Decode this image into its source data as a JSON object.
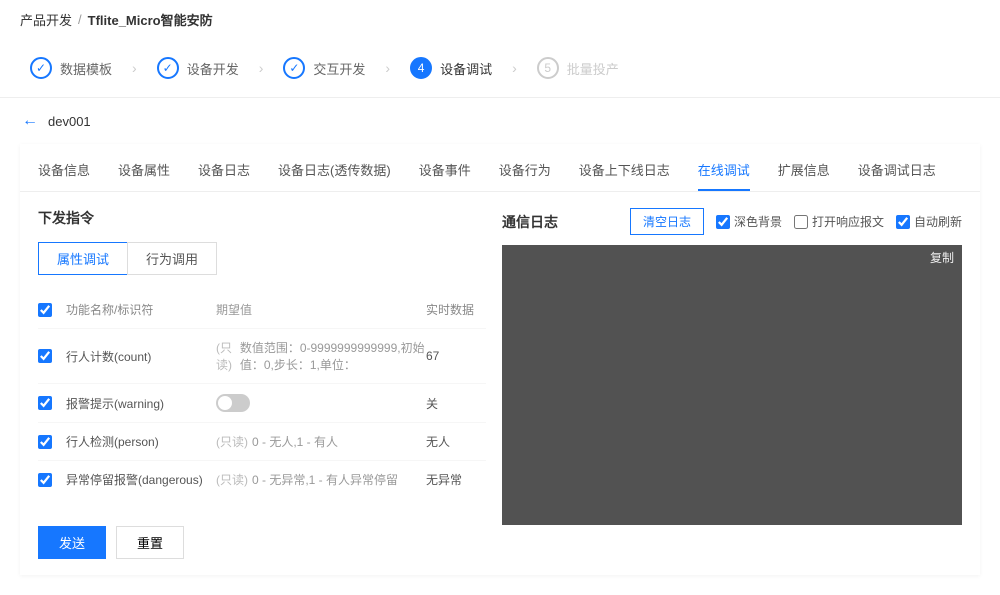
{
  "breadcrumb": {
    "parent": "产品开发",
    "current": "Tflite_Micro智能安防"
  },
  "steps": [
    {
      "label": "数据模板",
      "state": "done"
    },
    {
      "label": "设备开发",
      "state": "done"
    },
    {
      "label": "交互开发",
      "state": "done"
    },
    {
      "label": "设备调试",
      "num": "4",
      "state": "active"
    },
    {
      "label": "批量投产",
      "num": "5",
      "state": "pending"
    }
  ],
  "device": "dev001",
  "tabs": [
    "设备信息",
    "设备属性",
    "设备日志",
    "设备日志(透传数据)",
    "设备事件",
    "设备行为",
    "设备上下线日志",
    "在线调试",
    "扩展信息",
    "设备调试日志"
  ],
  "active_tab": "在线调试",
  "left": {
    "title": "下发指令",
    "subtabs": {
      "a": "属性调试",
      "b": "行为调用"
    },
    "header": {
      "name": "功能名称/标识符",
      "expect": "期望值",
      "real": "实时数据"
    },
    "rows": [
      {
        "name": "行人计数(count)",
        "readonly": "(只读)",
        "expect": "数值范围：0-9999999999999,初始值：0,步长：1,单位：",
        "real": "67",
        "type": "text"
      },
      {
        "name": "报警提示(warning)",
        "readonly": "",
        "expect": "",
        "real": "关",
        "type": "toggle"
      },
      {
        "name": "行人检测(person)",
        "readonly": "(只读)",
        "expect": "0 - 无人,1 - 有人",
        "real": "无人",
        "type": "text"
      },
      {
        "name": "异常停留报警(dangerous)",
        "readonly": "(只读)",
        "expect": "0 - 无异常,1 - 有人异常停留",
        "real": "无异常",
        "type": "text"
      }
    ],
    "actions": {
      "send": "发送",
      "reset": "重置"
    }
  },
  "right": {
    "title": "通信日志",
    "clear": "清空日志",
    "opts": {
      "dark": "深色背景",
      "expand": "打开响应报文",
      "auto": "自动刷新"
    },
    "copy": "复制"
  }
}
